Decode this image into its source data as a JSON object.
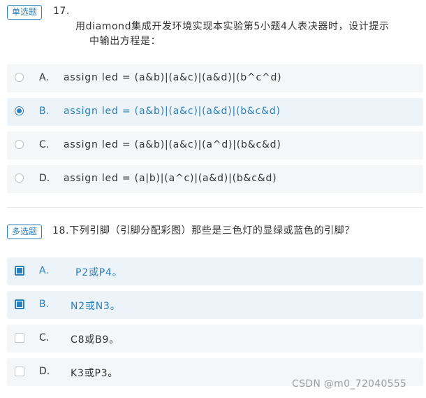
{
  "q17": {
    "tag": "单选题",
    "number": "17.",
    "text_line1": "用diamond集成开发环境实现本实验第5小题4人表决器时，设计提示",
    "text_line2": "中输出方程是：",
    "options": [
      {
        "letter": "A.",
        "text": "assign led = (a&b)|(a&c)|(a&d)|(b^c^d)",
        "selected": false
      },
      {
        "letter": "B.",
        "text": "assign led = (a&b)|(a&c)|(a&d)|(b&c&d)",
        "selected": true
      },
      {
        "letter": "C.",
        "text": "assign led = (a&b)|(a&c)|(a^d)|(b&c&d)",
        "selected": false
      },
      {
        "letter": "D.",
        "text": "assign led = (a|b)|(a^c)|(a&d)|(b&c&d)",
        "selected": false
      }
    ]
  },
  "q18": {
    "tag": "多选题",
    "question": "18.下列引脚（引脚分配彩图）那些是三色灯的显绿或蓝色的引脚？",
    "options": [
      {
        "letter": "A.",
        "text": "P2或P4。",
        "selected": true
      },
      {
        "letter": "B.",
        "text": "N2或N3。",
        "selected": true
      },
      {
        "letter": "C.",
        "text": "C8或B9。",
        "selected": false
      },
      {
        "letter": "D.",
        "text": "K3或P3。",
        "selected": false
      }
    ]
  },
  "watermark": "CSDN @m0_72040555",
  "colors": {
    "accent": "#2d7fb8",
    "option_bg": "#f4f6f8",
    "selected_bg": "#edf4f9"
  }
}
